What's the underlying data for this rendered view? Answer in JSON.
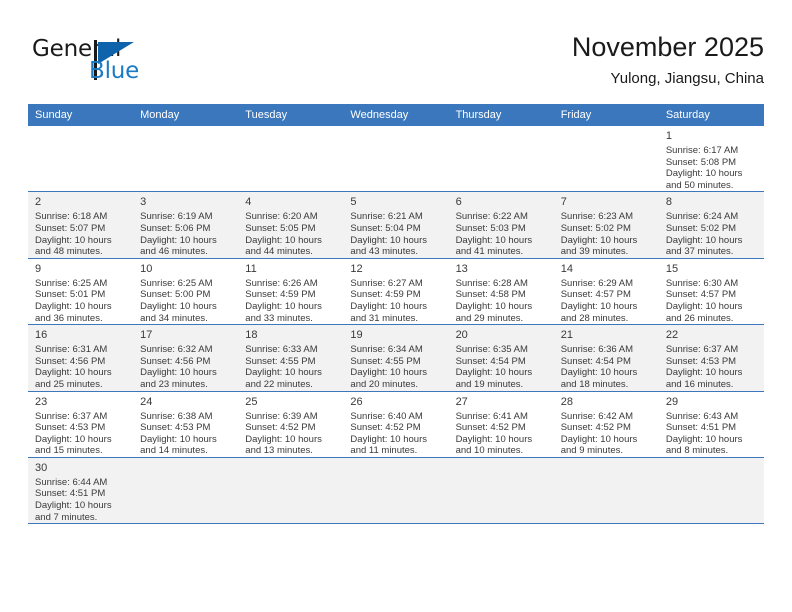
{
  "brand": {
    "name_part1": "General",
    "name_part2": "Blue",
    "accent_color": "#1b7bc4",
    "flag_color": "#0e63ab"
  },
  "header": {
    "month_title": "November 2025",
    "location": "Yulong, Jiangsu, China"
  },
  "theme": {
    "header_row_color": "#3b77bd",
    "shaded_row_color": "#f2f2f2",
    "text_color": "#3a3a3a"
  },
  "weekdays": [
    "Sunday",
    "Monday",
    "Tuesday",
    "Wednesday",
    "Thursday",
    "Friday",
    "Saturday"
  ],
  "weeks": [
    {
      "shaded": false,
      "days": [
        {
          "empty": true
        },
        {
          "empty": true
        },
        {
          "empty": true
        },
        {
          "empty": true
        },
        {
          "empty": true
        },
        {
          "empty": true
        },
        {
          "day": "1",
          "sunrise": "Sunrise: 6:17 AM",
          "sunset": "Sunset: 5:08 PM",
          "daylight_line1": "Daylight: 10 hours",
          "daylight_line2": "and 50 minutes."
        }
      ]
    },
    {
      "shaded": true,
      "days": [
        {
          "day": "2",
          "sunrise": "Sunrise: 6:18 AM",
          "sunset": "Sunset: 5:07 PM",
          "daylight_line1": "Daylight: 10 hours",
          "daylight_line2": "and 48 minutes."
        },
        {
          "day": "3",
          "sunrise": "Sunrise: 6:19 AM",
          "sunset": "Sunset: 5:06 PM",
          "daylight_line1": "Daylight: 10 hours",
          "daylight_line2": "and 46 minutes."
        },
        {
          "day": "4",
          "sunrise": "Sunrise: 6:20 AM",
          "sunset": "Sunset: 5:05 PM",
          "daylight_line1": "Daylight: 10 hours",
          "daylight_line2": "and 44 minutes."
        },
        {
          "day": "5",
          "sunrise": "Sunrise: 6:21 AM",
          "sunset": "Sunset: 5:04 PM",
          "daylight_line1": "Daylight: 10 hours",
          "daylight_line2": "and 43 minutes."
        },
        {
          "day": "6",
          "sunrise": "Sunrise: 6:22 AM",
          "sunset": "Sunset: 5:03 PM",
          "daylight_line1": "Daylight: 10 hours",
          "daylight_line2": "and 41 minutes."
        },
        {
          "day": "7",
          "sunrise": "Sunrise: 6:23 AM",
          "sunset": "Sunset: 5:02 PM",
          "daylight_line1": "Daylight: 10 hours",
          "daylight_line2": "and 39 minutes."
        },
        {
          "day": "8",
          "sunrise": "Sunrise: 6:24 AM",
          "sunset": "Sunset: 5:02 PM",
          "daylight_line1": "Daylight: 10 hours",
          "daylight_line2": "and 37 minutes."
        }
      ]
    },
    {
      "shaded": false,
      "days": [
        {
          "day": "9",
          "sunrise": "Sunrise: 6:25 AM",
          "sunset": "Sunset: 5:01 PM",
          "daylight_line1": "Daylight: 10 hours",
          "daylight_line2": "and 36 minutes."
        },
        {
          "day": "10",
          "sunrise": "Sunrise: 6:25 AM",
          "sunset": "Sunset: 5:00 PM",
          "daylight_line1": "Daylight: 10 hours",
          "daylight_line2": "and 34 minutes."
        },
        {
          "day": "11",
          "sunrise": "Sunrise: 6:26 AM",
          "sunset": "Sunset: 4:59 PM",
          "daylight_line1": "Daylight: 10 hours",
          "daylight_line2": "and 33 minutes."
        },
        {
          "day": "12",
          "sunrise": "Sunrise: 6:27 AM",
          "sunset": "Sunset: 4:59 PM",
          "daylight_line1": "Daylight: 10 hours",
          "daylight_line2": "and 31 minutes."
        },
        {
          "day": "13",
          "sunrise": "Sunrise: 6:28 AM",
          "sunset": "Sunset: 4:58 PM",
          "daylight_line1": "Daylight: 10 hours",
          "daylight_line2": "and 29 minutes."
        },
        {
          "day": "14",
          "sunrise": "Sunrise: 6:29 AM",
          "sunset": "Sunset: 4:57 PM",
          "daylight_line1": "Daylight: 10 hours",
          "daylight_line2": "and 28 minutes."
        },
        {
          "day": "15",
          "sunrise": "Sunrise: 6:30 AM",
          "sunset": "Sunset: 4:57 PM",
          "daylight_line1": "Daylight: 10 hours",
          "daylight_line2": "and 26 minutes."
        }
      ]
    },
    {
      "shaded": true,
      "days": [
        {
          "day": "16",
          "sunrise": "Sunrise: 6:31 AM",
          "sunset": "Sunset: 4:56 PM",
          "daylight_line1": "Daylight: 10 hours",
          "daylight_line2": "and 25 minutes."
        },
        {
          "day": "17",
          "sunrise": "Sunrise: 6:32 AM",
          "sunset": "Sunset: 4:56 PM",
          "daylight_line1": "Daylight: 10 hours",
          "daylight_line2": "and 23 minutes."
        },
        {
          "day": "18",
          "sunrise": "Sunrise: 6:33 AM",
          "sunset": "Sunset: 4:55 PM",
          "daylight_line1": "Daylight: 10 hours",
          "daylight_line2": "and 22 minutes."
        },
        {
          "day": "19",
          "sunrise": "Sunrise: 6:34 AM",
          "sunset": "Sunset: 4:55 PM",
          "daylight_line1": "Daylight: 10 hours",
          "daylight_line2": "and 20 minutes."
        },
        {
          "day": "20",
          "sunrise": "Sunrise: 6:35 AM",
          "sunset": "Sunset: 4:54 PM",
          "daylight_line1": "Daylight: 10 hours",
          "daylight_line2": "and 19 minutes."
        },
        {
          "day": "21",
          "sunrise": "Sunrise: 6:36 AM",
          "sunset": "Sunset: 4:54 PM",
          "daylight_line1": "Daylight: 10 hours",
          "daylight_line2": "and 18 minutes."
        },
        {
          "day": "22",
          "sunrise": "Sunrise: 6:37 AM",
          "sunset": "Sunset: 4:53 PM",
          "daylight_line1": "Daylight: 10 hours",
          "daylight_line2": "and 16 minutes."
        }
      ]
    },
    {
      "shaded": false,
      "days": [
        {
          "day": "23",
          "sunrise": "Sunrise: 6:37 AM",
          "sunset": "Sunset: 4:53 PM",
          "daylight_line1": "Daylight: 10 hours",
          "daylight_line2": "and 15 minutes."
        },
        {
          "day": "24",
          "sunrise": "Sunrise: 6:38 AM",
          "sunset": "Sunset: 4:53 PM",
          "daylight_line1": "Daylight: 10 hours",
          "daylight_line2": "and 14 minutes."
        },
        {
          "day": "25",
          "sunrise": "Sunrise: 6:39 AM",
          "sunset": "Sunset: 4:52 PM",
          "daylight_line1": "Daylight: 10 hours",
          "daylight_line2": "and 13 minutes."
        },
        {
          "day": "26",
          "sunrise": "Sunrise: 6:40 AM",
          "sunset": "Sunset: 4:52 PM",
          "daylight_line1": "Daylight: 10 hours",
          "daylight_line2": "and 11 minutes."
        },
        {
          "day": "27",
          "sunrise": "Sunrise: 6:41 AM",
          "sunset": "Sunset: 4:52 PM",
          "daylight_line1": "Daylight: 10 hours",
          "daylight_line2": "and 10 minutes."
        },
        {
          "day": "28",
          "sunrise": "Sunrise: 6:42 AM",
          "sunset": "Sunset: 4:52 PM",
          "daylight_line1": "Daylight: 10 hours",
          "daylight_line2": "and 9 minutes."
        },
        {
          "day": "29",
          "sunrise": "Sunrise: 6:43 AM",
          "sunset": "Sunset: 4:51 PM",
          "daylight_line1": "Daylight: 10 hours",
          "daylight_line2": "and 8 minutes."
        }
      ]
    },
    {
      "shaded": true,
      "days": [
        {
          "day": "30",
          "sunrise": "Sunrise: 6:44 AM",
          "sunset": "Sunset: 4:51 PM",
          "daylight_line1": "Daylight: 10 hours",
          "daylight_line2": "and 7 minutes."
        },
        {
          "empty": true
        },
        {
          "empty": true
        },
        {
          "empty": true
        },
        {
          "empty": true
        },
        {
          "empty": true
        },
        {
          "empty": true
        }
      ]
    }
  ]
}
